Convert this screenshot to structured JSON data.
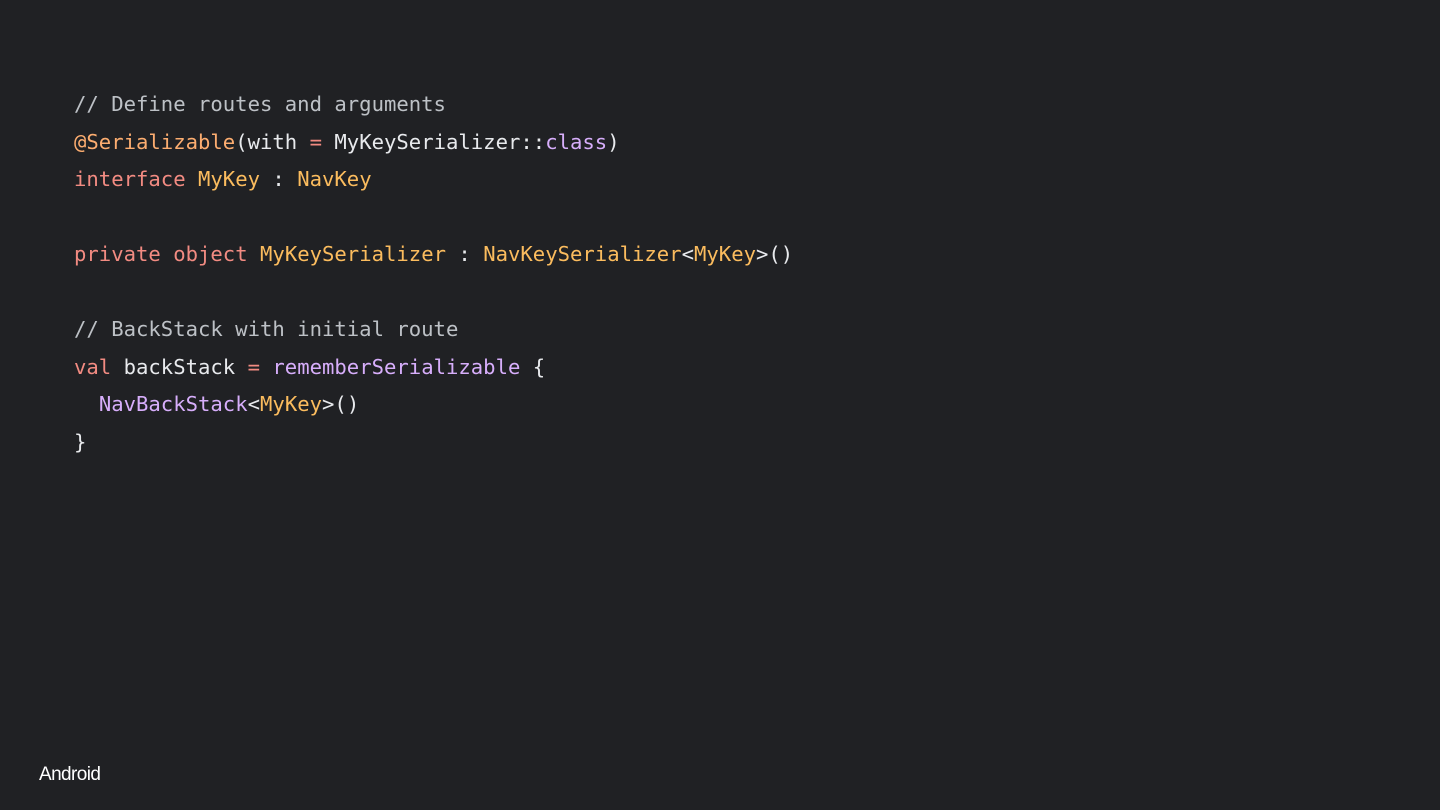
{
  "colors": {
    "background": "#202124",
    "comment": "#bdc1c6",
    "keyword": "#f28b82",
    "annotation": "#fcad70",
    "type": "#fbbc5e",
    "function": "#d7aefb",
    "plain": "#e8eaed"
  },
  "code": {
    "lines": [
      [
        {
          "t": "// Define routes and arguments",
          "k": "comment"
        }
      ],
      [
        {
          "t": "@Serializable",
          "k": "annotation"
        },
        {
          "t": "(with ",
          "k": "plain"
        },
        {
          "t": "=",
          "k": "op"
        },
        {
          "t": " MyKeySerializer::",
          "k": "plain"
        },
        {
          "t": "class",
          "k": "func"
        },
        {
          "t": ")",
          "k": "plain"
        }
      ],
      [
        {
          "t": "interface",
          "k": "keyword"
        },
        {
          "t": " ",
          "k": "plain"
        },
        {
          "t": "MyKey",
          "k": "type"
        },
        {
          "t": " : ",
          "k": "plain"
        },
        {
          "t": "NavKey",
          "k": "type"
        }
      ],
      [],
      [
        {
          "t": "private",
          "k": "keyword"
        },
        {
          "t": " ",
          "k": "plain"
        },
        {
          "t": "object",
          "k": "keyword"
        },
        {
          "t": " ",
          "k": "plain"
        },
        {
          "t": "MyKeySerializer",
          "k": "type"
        },
        {
          "t": " : ",
          "k": "plain"
        },
        {
          "t": "NavKeySerializer",
          "k": "type"
        },
        {
          "t": "<",
          "k": "plain"
        },
        {
          "t": "MyKey",
          "k": "type"
        },
        {
          "t": ">()",
          "k": "plain"
        }
      ],
      [],
      [
        {
          "t": "// BackStack with initial route",
          "k": "comment"
        }
      ],
      [
        {
          "t": "val",
          "k": "keyword"
        },
        {
          "t": " backStack ",
          "k": "plain"
        },
        {
          "t": "=",
          "k": "op"
        },
        {
          "t": " ",
          "k": "plain"
        },
        {
          "t": "rememberSerializable",
          "k": "func"
        },
        {
          "t": " {",
          "k": "plain"
        }
      ],
      [
        {
          "t": "  ",
          "k": "plain"
        },
        {
          "t": "NavBackStack",
          "k": "func"
        },
        {
          "t": "<",
          "k": "plain"
        },
        {
          "t": "MyKey",
          "k": "type"
        },
        {
          "t": ">()",
          "k": "plain"
        }
      ],
      [
        {
          "t": "}",
          "k": "plain"
        }
      ]
    ]
  },
  "footer": {
    "logo_text": "Android"
  }
}
